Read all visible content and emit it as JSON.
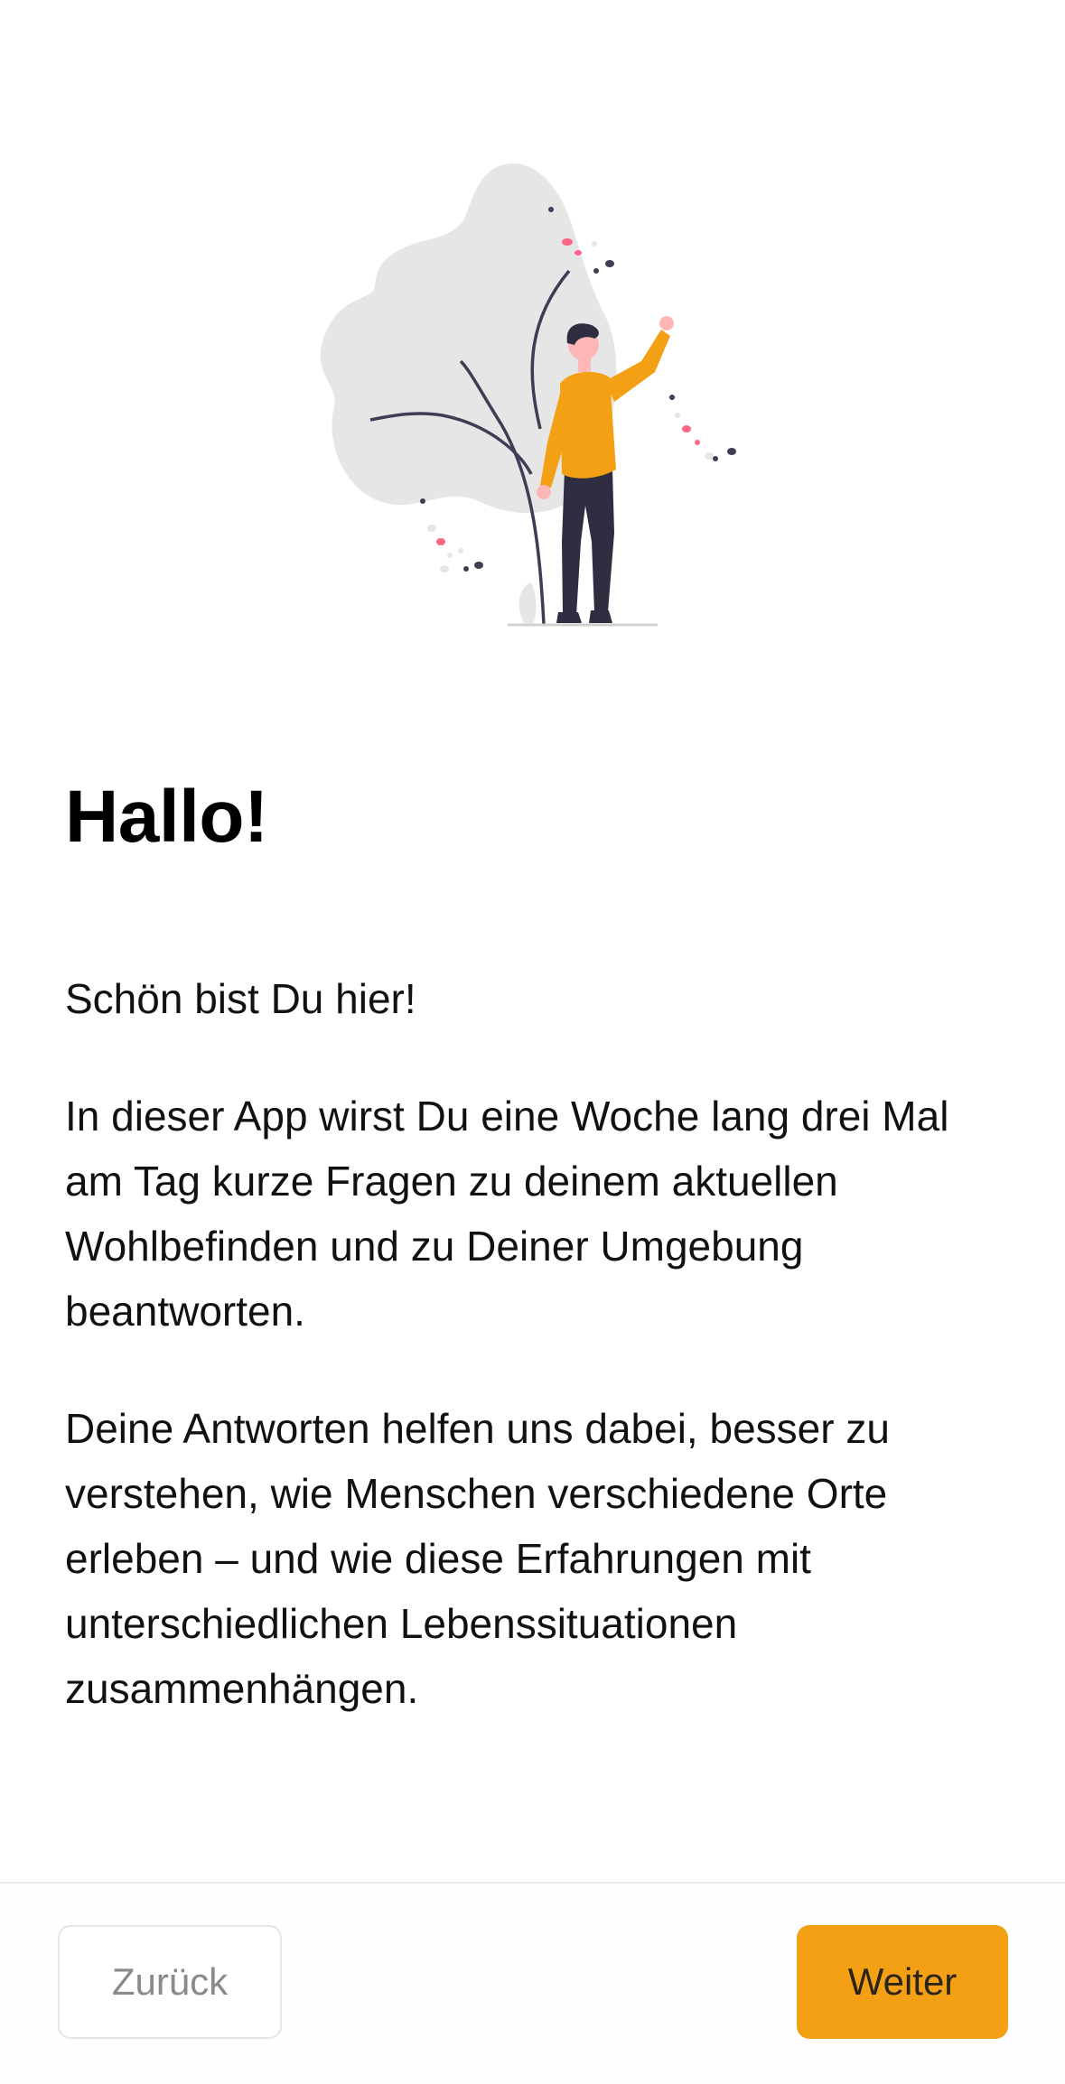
{
  "illustration": {
    "icon": "person-waving-illustration",
    "colors": {
      "blob": "#e6e6e6",
      "sweater": "#f4a015",
      "pants": "#2f2e41",
      "skin": "#ffb6b6",
      "accent": "#ff6584"
    }
  },
  "welcome": {
    "title": "Hallo!",
    "greeting": "Schön bist Du hier!",
    "intro": "In dieser App wirst Du eine Woche lang drei Mal am Tag kurze Fragen zu deinem aktuellen Wohlbefinden und zu Deiner Umgebung beantworten.",
    "purpose": "Deine Antworten helfen uns dabei, besser zu verstehen, wie Menschen verschiedene Orte erleben – und wie diese Erfahrungen mit unterschiedlichen Lebenssituationen zusammenhängen."
  },
  "footer": {
    "back_label": "Zurück",
    "next_label": "Weiter",
    "accent_color": "#f4a015"
  }
}
